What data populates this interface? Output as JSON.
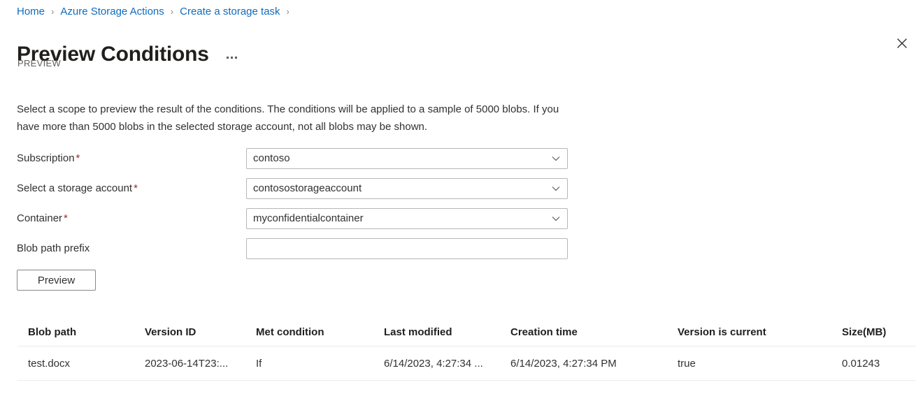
{
  "breadcrumb": {
    "items": [
      {
        "label": "Home"
      },
      {
        "label": "Azure Storage Actions"
      },
      {
        "label": "Create a storage task"
      }
    ],
    "separator": "›"
  },
  "header": {
    "title": "Preview Conditions",
    "subtitle": "PREVIEW",
    "more_menu": "…",
    "close_label": "Close"
  },
  "description": "Select a scope to preview the result of the conditions. The conditions will be applied to a sample of 5000 blobs. If you have more than 5000 blobs in the selected storage account, not all blobs may be shown.",
  "form": {
    "fields": [
      {
        "label": "Subscription",
        "required": "*",
        "type": "dropdown",
        "value": "contoso",
        "placeholder": ""
      },
      {
        "label": "Select a storage account",
        "required": "*",
        "type": "dropdown",
        "value": "contosostorageaccount",
        "placeholder": ""
      },
      {
        "label": "Container",
        "required": "*",
        "type": "dropdown",
        "value": "myconfidentialcontainer",
        "placeholder": ""
      },
      {
        "label": "Blob path prefix",
        "required": "",
        "type": "text",
        "value": "",
        "placeholder": ""
      }
    ],
    "preview_button": "Preview"
  },
  "table": {
    "columns": [
      "Blob path",
      "Version ID",
      "Met condition",
      "Last modified",
      "Creation time",
      "Version is current",
      "Size(MB)"
    ],
    "rows": [
      [
        "test.docx",
        "2023-06-14T23:...",
        "If",
        "6/14/2023, 4:27:34 ...",
        "6/14/2023, 4:27:34 PM",
        "true",
        "0.01243"
      ]
    ]
  },
  "colors": {
    "link": "#0f6cbd",
    "required": "#a4262c",
    "text": "#323130",
    "border": "#b7b7b7",
    "rule": "#edebe9"
  }
}
